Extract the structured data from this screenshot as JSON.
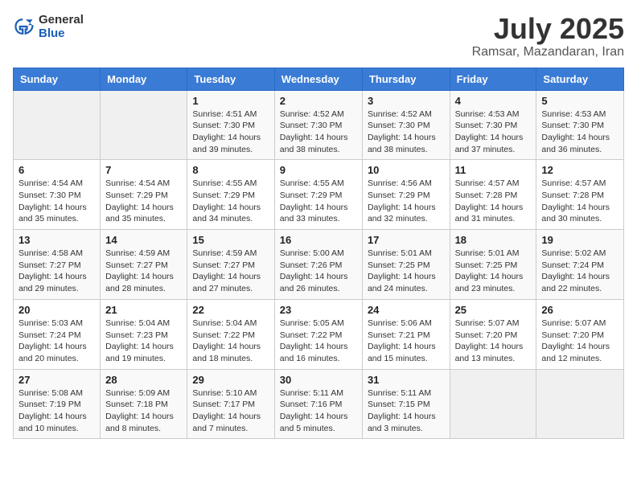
{
  "header": {
    "logo_general": "General",
    "logo_blue": "Blue",
    "month_title": "July 2025",
    "location": "Ramsar, Mazandaran, Iran"
  },
  "days_of_week": [
    "Sunday",
    "Monday",
    "Tuesday",
    "Wednesday",
    "Thursday",
    "Friday",
    "Saturday"
  ],
  "weeks": [
    [
      {
        "day": "",
        "empty": true
      },
      {
        "day": "",
        "empty": true
      },
      {
        "day": "1",
        "sunrise": "4:51 AM",
        "sunset": "7:30 PM",
        "daylight": "14 hours and 39 minutes."
      },
      {
        "day": "2",
        "sunrise": "4:52 AM",
        "sunset": "7:30 PM",
        "daylight": "14 hours and 38 minutes."
      },
      {
        "day": "3",
        "sunrise": "4:52 AM",
        "sunset": "7:30 PM",
        "daylight": "14 hours and 38 minutes."
      },
      {
        "day": "4",
        "sunrise": "4:53 AM",
        "sunset": "7:30 PM",
        "daylight": "14 hours and 37 minutes."
      },
      {
        "day": "5",
        "sunrise": "4:53 AM",
        "sunset": "7:30 PM",
        "daylight": "14 hours and 36 minutes."
      }
    ],
    [
      {
        "day": "6",
        "sunrise": "4:54 AM",
        "sunset": "7:30 PM",
        "daylight": "14 hours and 35 minutes."
      },
      {
        "day": "7",
        "sunrise": "4:54 AM",
        "sunset": "7:29 PM",
        "daylight": "14 hours and 35 minutes."
      },
      {
        "day": "8",
        "sunrise": "4:55 AM",
        "sunset": "7:29 PM",
        "daylight": "14 hours and 34 minutes."
      },
      {
        "day": "9",
        "sunrise": "4:55 AM",
        "sunset": "7:29 PM",
        "daylight": "14 hours and 33 minutes."
      },
      {
        "day": "10",
        "sunrise": "4:56 AM",
        "sunset": "7:29 PM",
        "daylight": "14 hours and 32 minutes."
      },
      {
        "day": "11",
        "sunrise": "4:57 AM",
        "sunset": "7:28 PM",
        "daylight": "14 hours and 31 minutes."
      },
      {
        "day": "12",
        "sunrise": "4:57 AM",
        "sunset": "7:28 PM",
        "daylight": "14 hours and 30 minutes."
      }
    ],
    [
      {
        "day": "13",
        "sunrise": "4:58 AM",
        "sunset": "7:27 PM",
        "daylight": "14 hours and 29 minutes."
      },
      {
        "day": "14",
        "sunrise": "4:59 AM",
        "sunset": "7:27 PM",
        "daylight": "14 hours and 28 minutes."
      },
      {
        "day": "15",
        "sunrise": "4:59 AM",
        "sunset": "7:27 PM",
        "daylight": "14 hours and 27 minutes."
      },
      {
        "day": "16",
        "sunrise": "5:00 AM",
        "sunset": "7:26 PM",
        "daylight": "14 hours and 26 minutes."
      },
      {
        "day": "17",
        "sunrise": "5:01 AM",
        "sunset": "7:25 PM",
        "daylight": "14 hours and 24 minutes."
      },
      {
        "day": "18",
        "sunrise": "5:01 AM",
        "sunset": "7:25 PM",
        "daylight": "14 hours and 23 minutes."
      },
      {
        "day": "19",
        "sunrise": "5:02 AM",
        "sunset": "7:24 PM",
        "daylight": "14 hours and 22 minutes."
      }
    ],
    [
      {
        "day": "20",
        "sunrise": "5:03 AM",
        "sunset": "7:24 PM",
        "daylight": "14 hours and 20 minutes."
      },
      {
        "day": "21",
        "sunrise": "5:04 AM",
        "sunset": "7:23 PM",
        "daylight": "14 hours and 19 minutes."
      },
      {
        "day": "22",
        "sunrise": "5:04 AM",
        "sunset": "7:22 PM",
        "daylight": "14 hours and 18 minutes."
      },
      {
        "day": "23",
        "sunrise": "5:05 AM",
        "sunset": "7:22 PM",
        "daylight": "14 hours and 16 minutes."
      },
      {
        "day": "24",
        "sunrise": "5:06 AM",
        "sunset": "7:21 PM",
        "daylight": "14 hours and 15 minutes."
      },
      {
        "day": "25",
        "sunrise": "5:07 AM",
        "sunset": "7:20 PM",
        "daylight": "14 hours and 13 minutes."
      },
      {
        "day": "26",
        "sunrise": "5:07 AM",
        "sunset": "7:20 PM",
        "daylight": "14 hours and 12 minutes."
      }
    ],
    [
      {
        "day": "27",
        "sunrise": "5:08 AM",
        "sunset": "7:19 PM",
        "daylight": "14 hours and 10 minutes."
      },
      {
        "day": "28",
        "sunrise": "5:09 AM",
        "sunset": "7:18 PM",
        "daylight": "14 hours and 8 minutes."
      },
      {
        "day": "29",
        "sunrise": "5:10 AM",
        "sunset": "7:17 PM",
        "daylight": "14 hours and 7 minutes."
      },
      {
        "day": "30",
        "sunrise": "5:11 AM",
        "sunset": "7:16 PM",
        "daylight": "14 hours and 5 minutes."
      },
      {
        "day": "31",
        "sunrise": "5:11 AM",
        "sunset": "7:15 PM",
        "daylight": "14 hours and 3 minutes."
      },
      {
        "day": "",
        "empty": true
      },
      {
        "day": "",
        "empty": true
      }
    ]
  ]
}
